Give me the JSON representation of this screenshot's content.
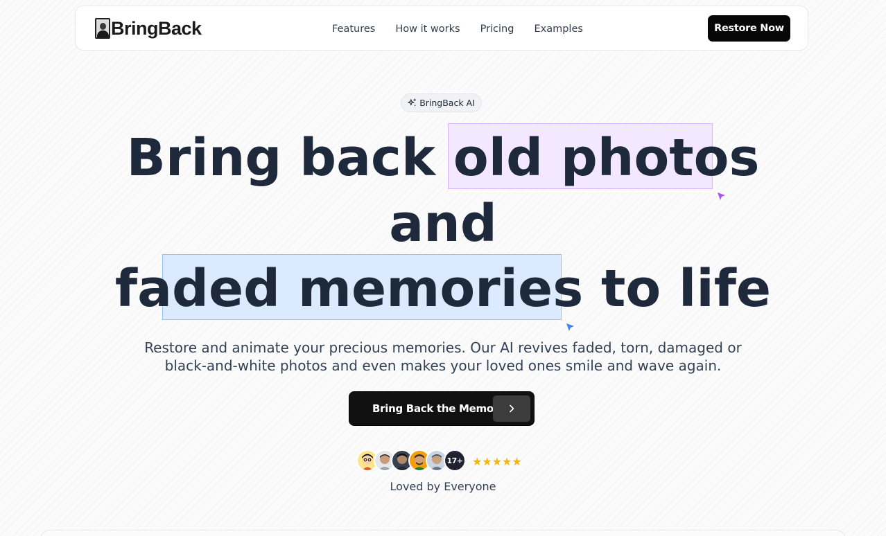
{
  "nav": {
    "logo_text": "BringBack",
    "links": [
      "Features",
      "How it works",
      "Pricing",
      "Examples"
    ],
    "cta_label": "Restore Now"
  },
  "badge": {
    "label": "BringBack AI",
    "icon": "sparkles-icon"
  },
  "hero": {
    "line1_plain": "Bring back ",
    "line1_highlight": "old photos",
    "line2": "and",
    "line3_highlight": "faded memories",
    "line3_plain": " to life",
    "subtitle_line1": "Restore and animate your precious memories. Our AI revives faded, torn, damaged or",
    "subtitle_line2": "black-and-white photos and even makes your loved ones smile and wave again.",
    "cta_label": "Bring Back the Memories",
    "cta_icon": "chevron-right-icon"
  },
  "social_proof": {
    "count_label": "17+",
    "stars": "★★★★★",
    "rating": 5,
    "caption": "Loved by Everyone"
  },
  "colors": {
    "highlight_purple": "#f3e8ff",
    "highlight_blue": "#dbeafe",
    "cursor_purple": "#a855f7",
    "cursor_blue": "#3b82f6",
    "star": "#f5b700",
    "primary_button": "#070707"
  }
}
